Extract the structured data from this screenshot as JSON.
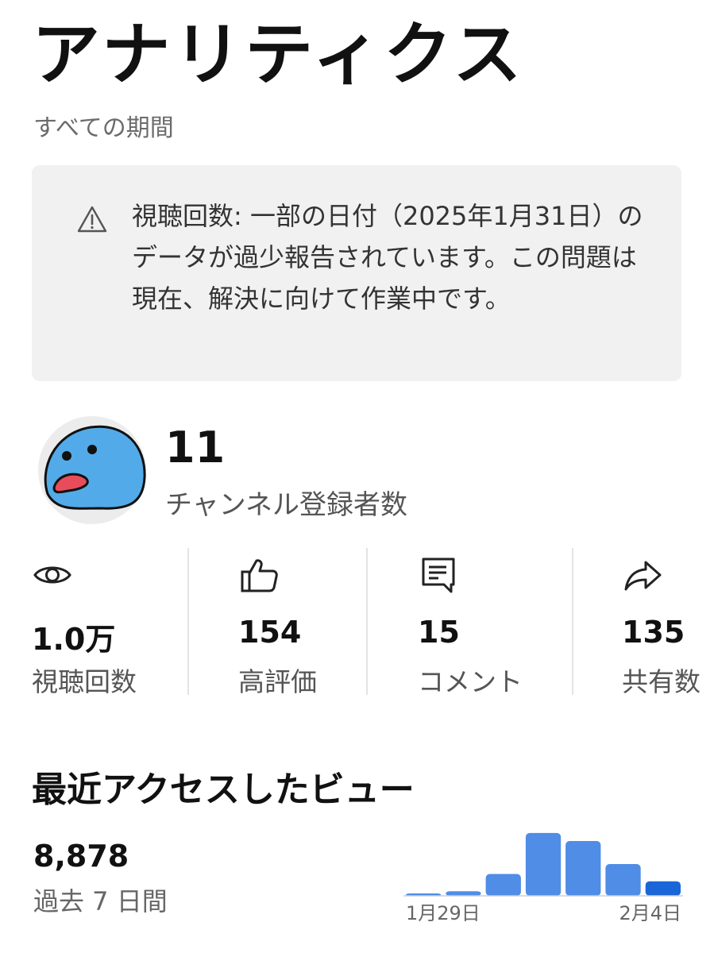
{
  "header": {
    "title": "アナリティクス",
    "period": "すべての期間"
  },
  "notice": {
    "icon": "warning-icon",
    "text": "視聴回数: 一部の日付（2025年1月31日）のデータが過少報告されています。この問題は現在、解決に向けて作業中です。"
  },
  "channel": {
    "avatar": "blue-blob-avatar",
    "subscriber_count": "11",
    "subscriber_label": "チャンネル登録者数"
  },
  "stats": [
    {
      "icon": "eye-icon",
      "value": "1.0万",
      "label": "視聴回数"
    },
    {
      "icon": "thumbs-up-icon",
      "value": "154",
      "label": "高評価"
    },
    {
      "icon": "comment-icon",
      "value": "15",
      "label": "コメント"
    },
    {
      "icon": "share-icon",
      "value": "135",
      "label": "共有数"
    }
  ],
  "recent": {
    "title": "最近アクセスしたビュー",
    "value": "8,878",
    "period_label": "過去 7 日間"
  },
  "colors": {
    "bar": "#4f8de6",
    "bar_highlight": "#1a66d8",
    "notice_bg": "#f1f1f1"
  },
  "chart_data": {
    "type": "bar",
    "categories": [
      "1月29日",
      "",
      "",
      "",
      "",
      "",
      "2月4日"
    ],
    "values": [
      60,
      120,
      570,
      1640,
      1430,
      830,
      380
    ],
    "highlight_index": 6,
    "xlabel": "",
    "ylabel": "",
    "ylim": [
      0,
      1700
    ],
    "grid": false,
    "legend": "none"
  }
}
